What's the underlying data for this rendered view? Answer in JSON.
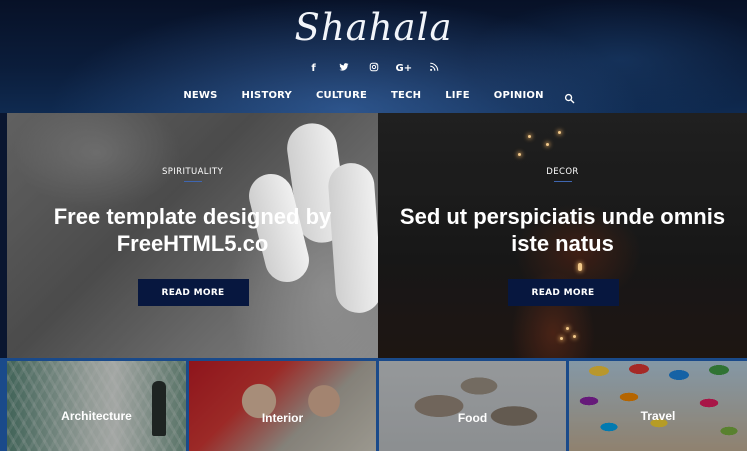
{
  "brand": {
    "logo": "Shahala"
  },
  "social": [
    {
      "name": "facebook",
      "glyph": "f"
    },
    {
      "name": "twitter",
      "glyph": "t"
    },
    {
      "name": "instagram",
      "glyph": "ig"
    },
    {
      "name": "google-plus",
      "glyph": "G+"
    },
    {
      "name": "rss",
      "glyph": "rss"
    }
  ],
  "nav": {
    "items": [
      "NEWS",
      "HISTORY",
      "CULTURE",
      "TECH",
      "LIFE",
      "OPINION"
    ]
  },
  "hero": [
    {
      "category": "SPIRITUALITY",
      "title": "Free template designed by FreeHTML5.co",
      "button": "READ MORE"
    },
    {
      "category": "DECOR",
      "title": "Sed ut perspiciatis unde omnis iste natus",
      "button": "READ MORE"
    }
  ],
  "categories": [
    "Architecture",
    "Interior",
    "Food",
    "Travel"
  ],
  "colors": {
    "header_bg": "#0b1d3b",
    "button_bg": "#07173f",
    "accent": "#1a4a8a"
  }
}
